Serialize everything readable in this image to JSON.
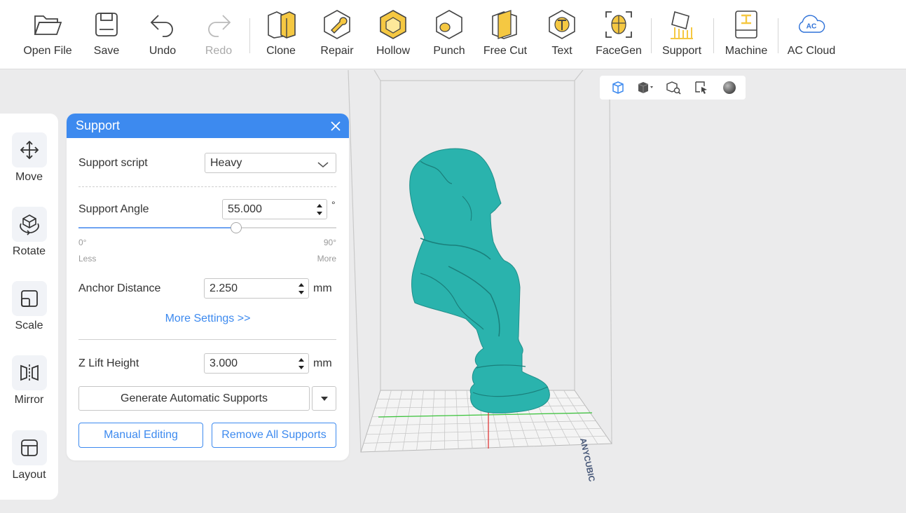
{
  "toolbar": {
    "items": [
      {
        "label": "Open File",
        "icon": "folder-icon",
        "enabled": true
      },
      {
        "label": "Save",
        "icon": "save-icon",
        "enabled": true
      },
      {
        "label": "Undo",
        "icon": "undo-icon",
        "enabled": true
      },
      {
        "label": "Redo",
        "icon": "redo-icon",
        "enabled": false
      },
      {
        "label": "Clone",
        "icon": "clone-icon",
        "enabled": true
      },
      {
        "label": "Repair",
        "icon": "repair-icon",
        "enabled": true
      },
      {
        "label": "Hollow",
        "icon": "hollow-icon",
        "enabled": true
      },
      {
        "label": "Punch",
        "icon": "punch-icon",
        "enabled": true
      },
      {
        "label": "Free Cut",
        "icon": "free-cut-icon",
        "enabled": true
      },
      {
        "label": "Text",
        "icon": "text-icon",
        "enabled": true
      },
      {
        "label": "FaceGen",
        "icon": "facegen-icon",
        "enabled": true
      },
      {
        "label": "Support",
        "icon": "support-icon",
        "enabled": true
      },
      {
        "label": "Machine",
        "icon": "machine-icon",
        "enabled": true
      },
      {
        "label": "AC Cloud",
        "icon": "ac-cloud-icon",
        "enabled": true
      }
    ],
    "cloud_badge": "AC"
  },
  "view_tools": [
    "view-cube-icon",
    "shading-mode-icon",
    "zoom-fit-icon",
    "select-cursor-icon",
    "material-sphere-icon"
  ],
  "sidebar": {
    "items": [
      {
        "label": "Move",
        "icon": "move-icon"
      },
      {
        "label": "Rotate",
        "icon": "rotate-icon"
      },
      {
        "label": "Scale",
        "icon": "scale-icon"
      },
      {
        "label": "Mirror",
        "icon": "mirror-icon"
      },
      {
        "label": "Layout",
        "icon": "layout-icon"
      }
    ]
  },
  "support_panel": {
    "title": "Support",
    "support_script_label": "Support script",
    "support_script_value": "Heavy",
    "angle_label": "Support Angle",
    "angle_value": "55.000",
    "angle_unit": "°",
    "angle_slider_fraction": 0.611,
    "angle_min": "0°",
    "angle_max": "90°",
    "angle_min_hint": "Less",
    "angle_max_hint": "More",
    "anchor_label": "Anchor Distance",
    "anchor_value": "2.250",
    "anchor_unit": "mm",
    "more_settings": "More Settings >>",
    "zlift_label": "Z Lift Height",
    "zlift_value": "3.000",
    "zlift_unit": "mm",
    "generate_button": "Generate Automatic Supports",
    "manual_button": "Manual Editing",
    "remove_button": "Remove All Supports"
  },
  "colors": {
    "accent": "#3d8aef",
    "model": "#2ab3ad",
    "background": "#ebebec"
  }
}
